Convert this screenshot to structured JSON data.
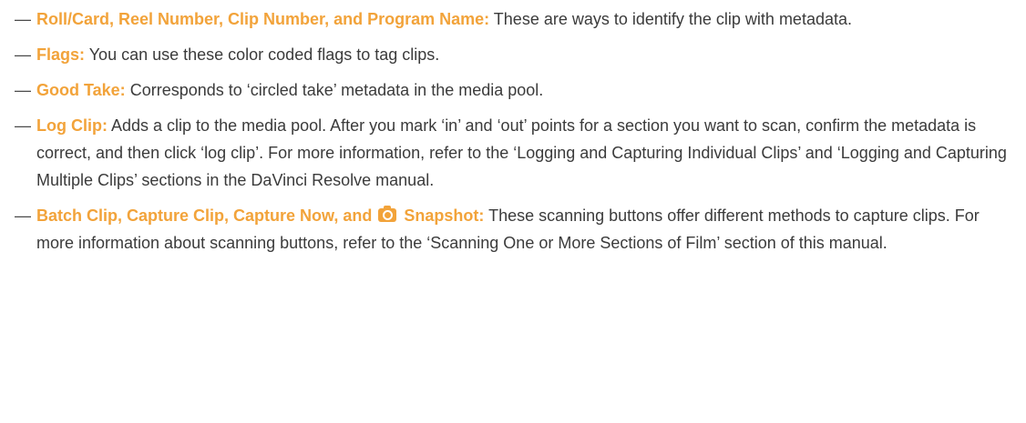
{
  "items": [
    {
      "term": "Roll/Card, Reel Number, Clip Number, and Program Name:",
      "text": "These are ways to identify the clip with metadata."
    },
    {
      "term": "Flags:",
      "text": "You can use these color coded flags to tag clips."
    },
    {
      "term": "Good Take:",
      "text": "Corresponds to ‘circled take’ metadata in the media pool."
    },
    {
      "term": "Log Clip:",
      "text": "Adds a clip to the media pool. After you mark ‘in’ and ‘out’ points for a section you want to scan, confirm the metadata is correct, and then click ‘log clip’. For more information, refer to the ‘Logging and Capturing Individual Clips’ and ‘Logging and Capturing Multiple Clips’ sections in the DaVinci Resolve manual."
    },
    {
      "term_before_icon": "Batch Clip, Capture Clip, Capture Now, and",
      "icon": "camera-icon",
      "term_after_icon": "Snapshot:",
      "text": "These scanning buttons offer different methods to capture clips. For more information about scanning buttons, refer to the ‘Scanning One or More Sections of Film’ section of this manual."
    }
  ],
  "dash": "—",
  "accent_color": "#f2a33a"
}
